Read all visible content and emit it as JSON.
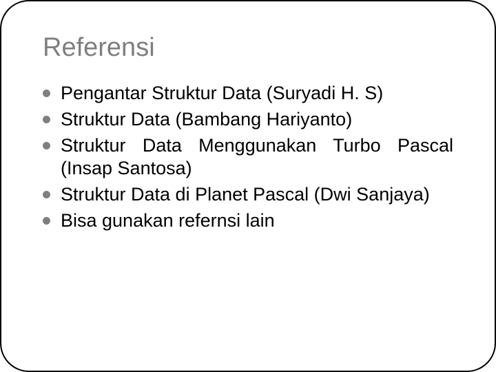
{
  "title": "Referensi",
  "items": [
    "Pengantar Struktur Data (Suryadi H. S)",
    "Struktur Data (Bambang Hariyanto)",
    "Struktur Data Menggunakan Turbo Pascal (Insap Santosa)",
    "Struktur Data di Planet Pascal (Dwi Sanjaya)",
    "Bisa gunakan refernsi lain"
  ]
}
